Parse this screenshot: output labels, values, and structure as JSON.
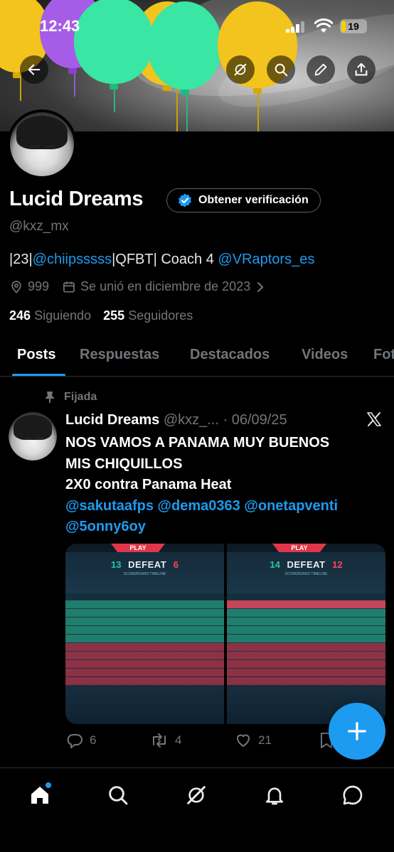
{
  "status_bar": {
    "time": "12:43",
    "battery": "19",
    "battery_level": 0.19
  },
  "profile": {
    "name": "Lucid Dreams",
    "verify_label": "Obtener verificación",
    "handle": "@kxz_mx",
    "bio_parts": [
      "|23|",
      "@chiipsssss",
      "|QFBT| Coach 4 ",
      "@VRaptors_es"
    ],
    "location": "999",
    "joined": "Se unió en diciembre de 2023",
    "following_count": "246",
    "following_label": "Siguiendo",
    "followers_count": "255",
    "followers_label": "Seguidores"
  },
  "tabs": [
    "Posts",
    "Respuestas",
    "Destacados",
    "Videos",
    "Fotos"
  ],
  "post": {
    "pinned_label": "Fijada",
    "author": "Lucid Dreams",
    "handle": "@kxz_...",
    "separator": "·",
    "date": "06/09/25",
    "lines": [
      "NOS VAMOS A PANAMA MUY BUENOS",
      "MIS CHIQUILLOS",
      "2X0 contra Panama Heat"
    ],
    "mentions_line1": "@sakutaafps @dema0363 @onetapventi",
    "mentions_line2": "@5onny6oy",
    "media": [
      {
        "play": "PLAY",
        "team_score": "13",
        "result": "DEFEAT",
        "enemy_score": "6",
        "sub": "SCOREBOARD     TIMELINE"
      },
      {
        "play": "PLAY",
        "team_score": "14",
        "result": "DEFEAT",
        "enemy_score": "12",
        "sub": "SCOREBOARD     TIMELINE"
      }
    ],
    "replies": "6",
    "reposts": "4",
    "likes": "21"
  },
  "icons": {
    "back": "back-arrow-icon",
    "grok": "grok-icon",
    "search": "search-icon",
    "edit": "pencil-icon",
    "share": "share-icon",
    "location": "location-pin-icon",
    "calendar": "calendar-icon",
    "pin": "pin-icon",
    "x": "x-logo-icon",
    "reply": "reply-icon",
    "repost": "repost-icon",
    "like": "heart-icon",
    "compose": "plus-icon",
    "home": "home-icon",
    "notifications": "bell-icon",
    "messages": "chat-icon"
  },
  "colors": {
    "accent": "#1d9bf0",
    "muted": "#71767b",
    "text": "#e7e9ea",
    "background": "#000000"
  }
}
